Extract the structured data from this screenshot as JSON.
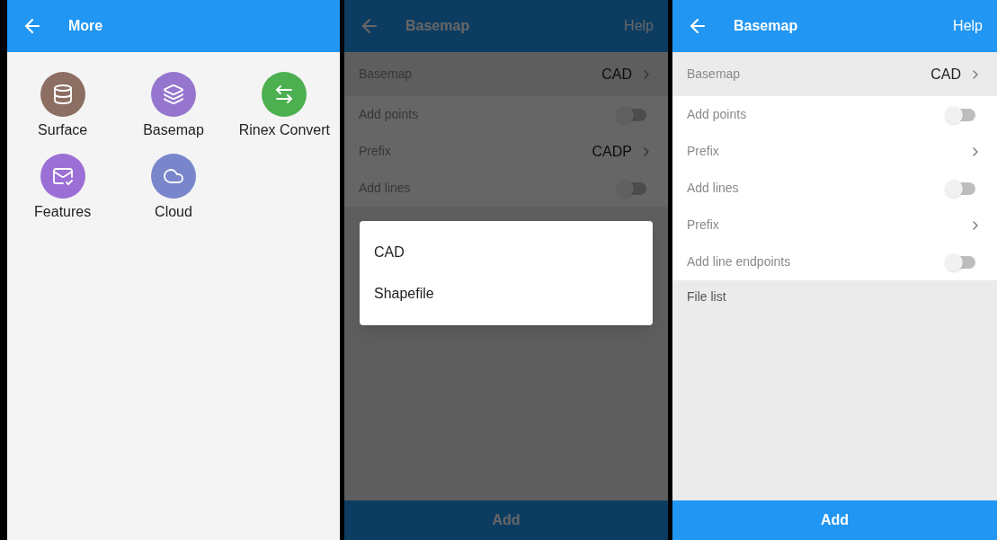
{
  "screens": [
    {
      "kind": "menu",
      "title": "More",
      "items": [
        {
          "label": "Surface",
          "color": "#8d6e63"
        },
        {
          "label": "Basemap",
          "color": "#9575cd"
        },
        {
          "label": "Rinex Convert",
          "color": "#4caf50"
        },
        {
          "label": "Features",
          "color": "#9c6fd6"
        },
        {
          "label": "Cloud",
          "color": "#7986cb"
        }
      ]
    },
    {
      "kind": "settings",
      "dimmed": true,
      "title": "Basemap",
      "action": "Help",
      "rows": [
        {
          "kind": "select",
          "label": "Basemap",
          "value": "CAD",
          "selected": true
        },
        {
          "kind": "toggle",
          "label": "Add points",
          "on": false
        },
        {
          "kind": "select",
          "label": "Prefix",
          "value": "CADP",
          "selected": false
        },
        {
          "kind": "toggle",
          "label": "Add lines",
          "on": false
        }
      ],
      "dialog": {
        "options": [
          "CAD",
          "Shapefile"
        ]
      },
      "button": "Add"
    },
    {
      "kind": "settings",
      "dimmed": false,
      "title": "Basemap",
      "action": "Help",
      "rows": [
        {
          "kind": "select",
          "label": "Basemap",
          "value": "CAD",
          "selected": true
        },
        {
          "kind": "toggle",
          "label": "Add points",
          "on": false
        },
        {
          "kind": "select",
          "label": "Prefix",
          "selected": false
        },
        {
          "kind": "toggle",
          "label": "Add lines",
          "on": false
        },
        {
          "kind": "select",
          "label": "Prefix",
          "selected": false
        },
        {
          "kind": "toggle",
          "label": "Add line endpoints",
          "on": false
        },
        {
          "kind": "section",
          "label": "File list"
        }
      ],
      "button": "Add"
    }
  ]
}
